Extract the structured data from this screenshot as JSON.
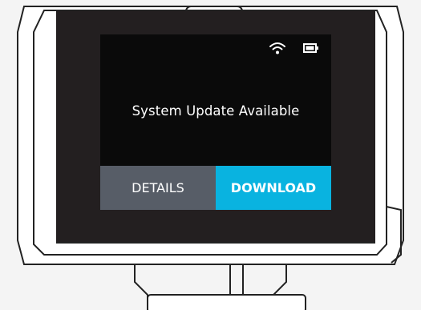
{
  "screen": {
    "message": "System Update Available",
    "status_icons": [
      "wifi-icon",
      "battery-icon"
    ]
  },
  "buttons": {
    "details_label": "DETAILS",
    "download_label": "DOWNLOAD"
  },
  "colors": {
    "screen_background": "#0a0a0a",
    "details_button": "#575d67",
    "download_button": "#09b3e0",
    "text": "#ffffff",
    "device_bezel": "#231f20",
    "device_body": "#f4f4f4"
  }
}
